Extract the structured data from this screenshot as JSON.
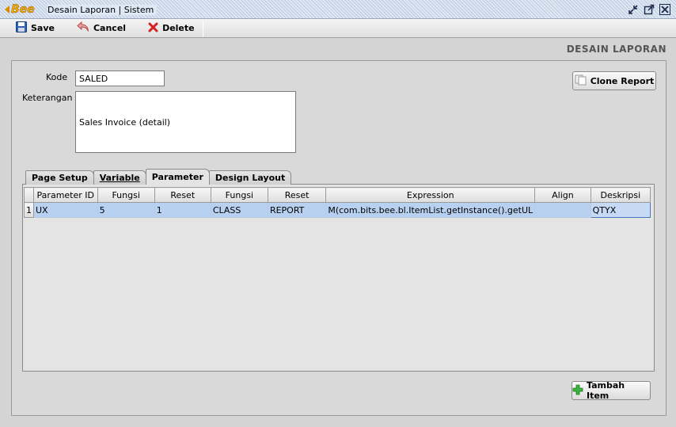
{
  "window": {
    "logo_text": "Bee",
    "title": "Desain Laporan | Sistem"
  },
  "toolbar": {
    "save_label": "Save",
    "cancel_label": "Cancel",
    "delete_label": "Delete"
  },
  "header": {
    "section_title": "DESAIN LAPORAN"
  },
  "form": {
    "kode_label": "Kode",
    "kode_value": "SALED",
    "keterangan_label": "Keterangan",
    "keterangan_value": "Sales Invoice (detail)",
    "clone_label": "Clone Report"
  },
  "tabs": [
    {
      "label": "Page Setup"
    },
    {
      "label": "Variable"
    },
    {
      "label": "Parameter"
    },
    {
      "label": "Design Layout"
    }
  ],
  "table": {
    "columns": [
      "Parameter ID",
      "Fungsi",
      "Reset",
      "Fungsi",
      "Reset",
      "Expression",
      "Align",
      "Deskripsi"
    ],
    "rows": [
      {
        "num": "1",
        "cells": [
          "UX",
          "5",
          "1",
          "CLASS",
          "REPORT",
          "M(com.bits.bee.bl.ItemList.getInstance().getUL",
          "",
          "QTYX"
        ]
      }
    ]
  },
  "footer": {
    "add_item_label": "Tambah Item"
  },
  "colors": {
    "selection": "#b9d1f0",
    "logo": "#f5a800",
    "delete_icon": "#d62020",
    "add_icon": "#2f9e2f"
  }
}
